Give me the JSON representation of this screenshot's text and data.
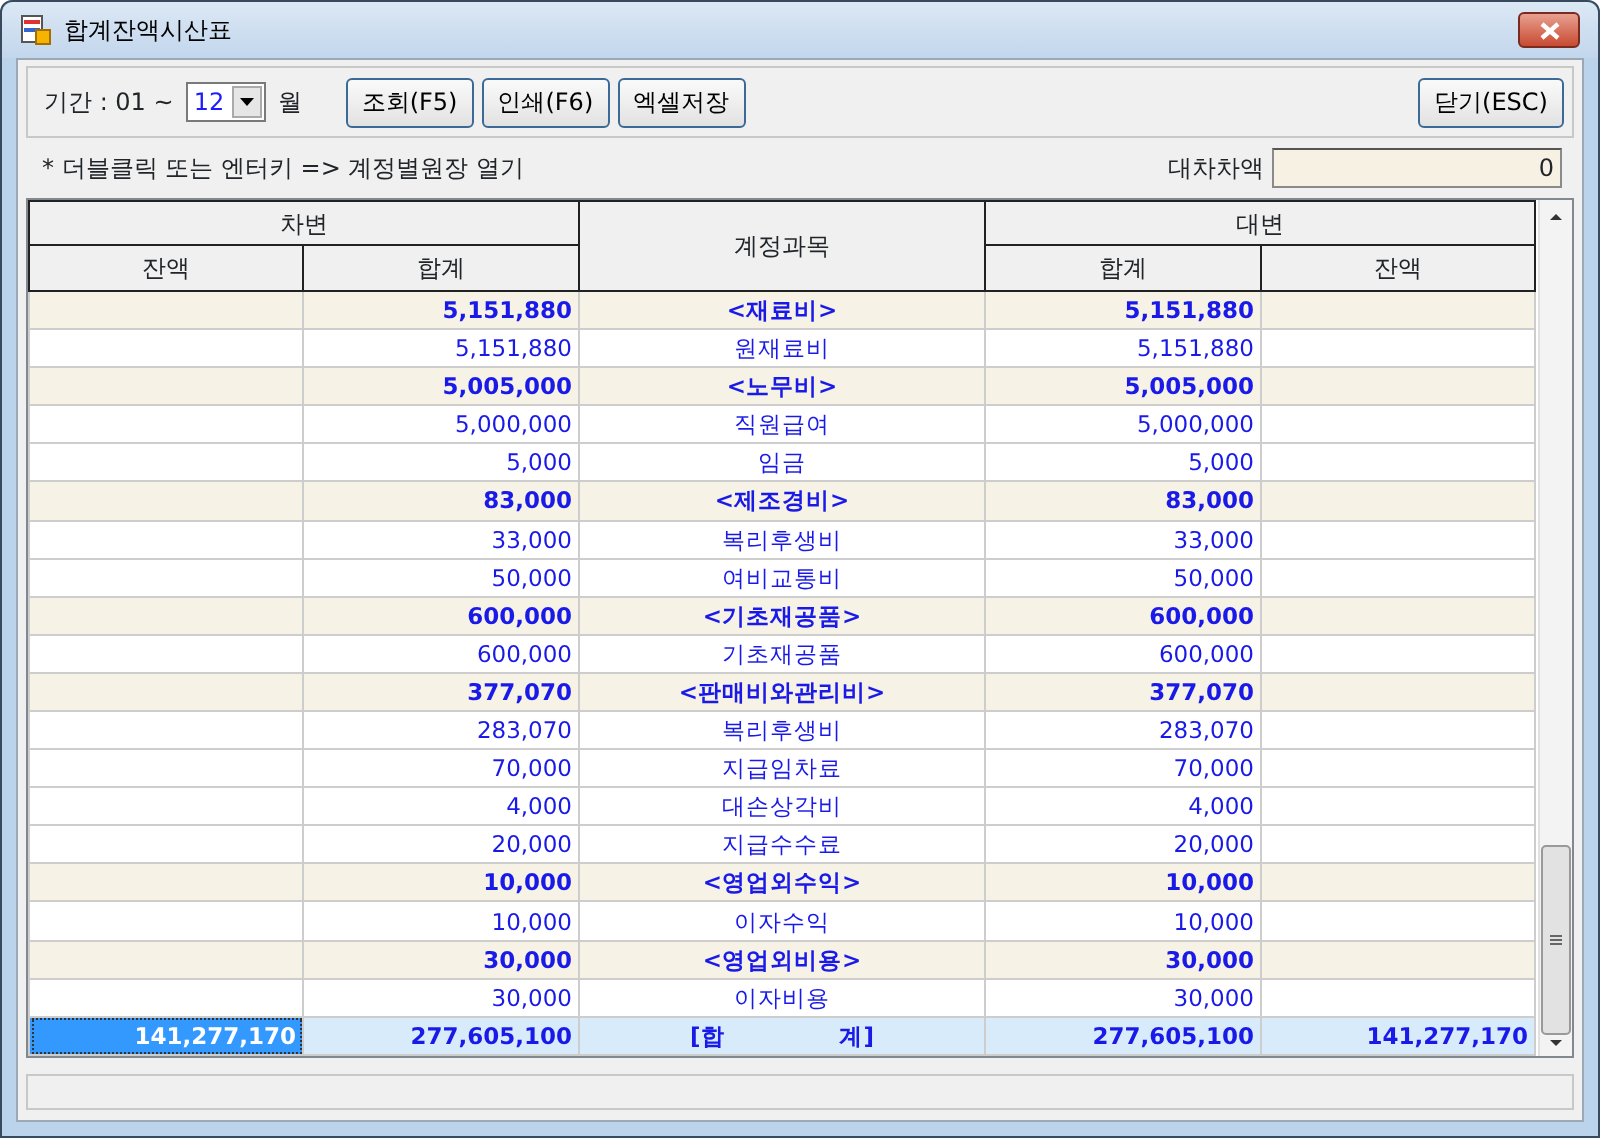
{
  "window": {
    "title": "합계잔액시산표"
  },
  "toolbar": {
    "period_label": "기간 : 01 ~",
    "month": "12",
    "month_unit": "월",
    "buttons": [
      "조회(F5)",
      "인쇄(F6)",
      "엑셀저장"
    ],
    "close_button": "닫기(ESC)"
  },
  "hint": "* 더블클릭 또는 엔터키 => 계정별원장 열기",
  "difference": {
    "label": "대차차액",
    "value": "0"
  },
  "table": {
    "debit_header": "차변",
    "credit_header": "대변",
    "account_header": "계정과목",
    "debit_columns": [
      "잔액",
      "합계"
    ],
    "credit_columns": [
      "합계",
      "잔액"
    ],
    "rows": [
      {
        "kind": "group",
        "selected": false,
        "debit_total": "5,151,880",
        "account": "<재료비>",
        "credit_total": "5,151,880"
      },
      {
        "kind": "item",
        "selected": false,
        "debit_total": "5,151,880",
        "account": "원재료비",
        "credit_total": "5,151,880"
      },
      {
        "kind": "group",
        "selected": false,
        "debit_total": "5,005,000",
        "account": "<노무비>",
        "credit_total": "5,005,000"
      },
      {
        "kind": "item",
        "selected": false,
        "debit_total": "5,000,000",
        "account": "직원급여",
        "credit_total": "5,000,000"
      },
      {
        "kind": "item",
        "selected": false,
        "debit_total": "5,000",
        "account": "임금",
        "credit_total": "5,000"
      },
      {
        "kind": "group",
        "selected": false,
        "debit_total": "83,000",
        "account": "<제조경비>",
        "credit_total": "83,000"
      },
      {
        "kind": "item",
        "selected": false,
        "debit_total": "33,000",
        "account": "복리후생비",
        "credit_total": "33,000"
      },
      {
        "kind": "item",
        "selected": false,
        "debit_total": "50,000",
        "account": "여비교통비",
        "credit_total": "50,000"
      },
      {
        "kind": "group",
        "selected": false,
        "debit_total": "600,000",
        "account": "<기초재공품>",
        "credit_total": "600,000"
      },
      {
        "kind": "item",
        "selected": false,
        "debit_total": "600,000",
        "account": "기초재공품",
        "credit_total": "600,000"
      },
      {
        "kind": "group",
        "selected": false,
        "debit_total": "377,070",
        "account": "<판매비와관리비>",
        "credit_total": "377,070"
      },
      {
        "kind": "item",
        "selected": false,
        "debit_total": "283,070",
        "account": "복리후생비",
        "credit_total": "283,070"
      },
      {
        "kind": "item",
        "selected": false,
        "debit_total": "70,000",
        "account": "지급임차료",
        "credit_total": "70,000"
      },
      {
        "kind": "item",
        "selected": false,
        "debit_total": "4,000",
        "account": "대손상각비",
        "credit_total": "4,000"
      },
      {
        "kind": "item",
        "selected": false,
        "debit_total": "20,000",
        "account": "지급수수료",
        "credit_total": "20,000"
      },
      {
        "kind": "group",
        "selected": false,
        "debit_total": "10,000",
        "account": "<영업외수익>",
        "credit_total": "10,000"
      },
      {
        "kind": "item",
        "selected": false,
        "debit_total": "10,000",
        "account": "이자수익",
        "credit_total": "10,000"
      },
      {
        "kind": "group",
        "selected": false,
        "debit_total": "30,000",
        "account": "<영업외비용>",
        "credit_total": "30,000"
      },
      {
        "kind": "item",
        "selected": false,
        "debit_total": "30,000",
        "account": "이자비용",
        "credit_total": "30,000"
      },
      {
        "kind": "total",
        "selected": true,
        "debit_balance": "141,277,170",
        "debit_total": "277,605,100",
        "account_parts": [
          "[합",
          "계]"
        ],
        "credit_total": "277,605,100",
        "credit_balance": "141,277,170"
      }
    ]
  }
}
